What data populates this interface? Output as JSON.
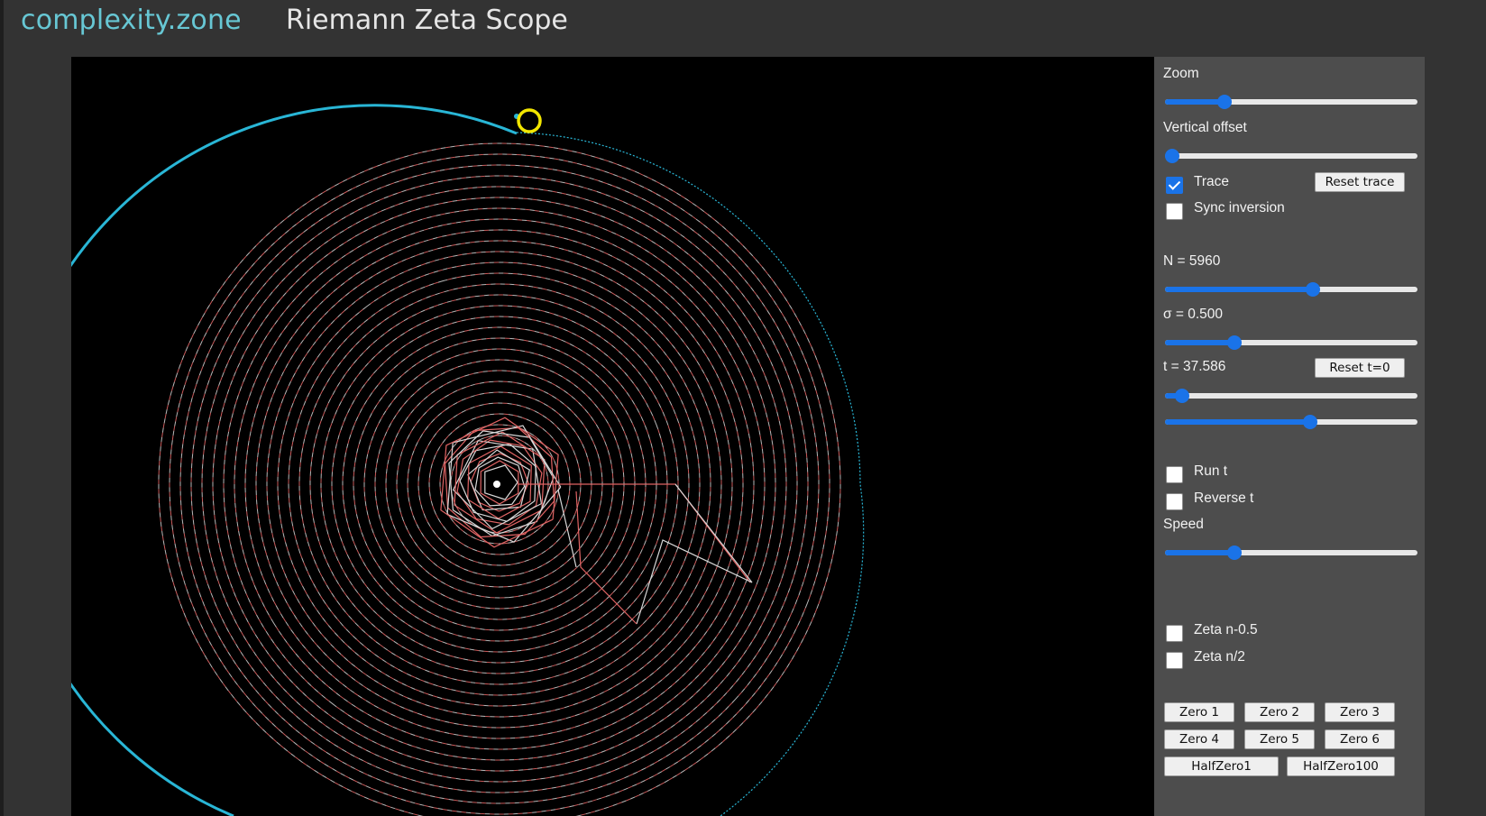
{
  "header": {
    "brand": "complexity.zone",
    "title": "Riemann Zeta Scope"
  },
  "controls": {
    "zoom": {
      "label": "Zoom",
      "value_fraction": 0.22
    },
    "vertical_offset": {
      "label": "Vertical offset",
      "value_fraction": 0.0
    },
    "trace": {
      "label": "Trace",
      "checked": true
    },
    "reset_trace": "Reset trace",
    "sync_inversion": {
      "label": "Sync inversion",
      "checked": false
    },
    "n": {
      "label": "N = 5960",
      "value_fraction": 0.59
    },
    "sigma": {
      "label": "σ = 0.500",
      "value_fraction": 0.26
    },
    "t": {
      "label": "t = 37.586",
      "value_fraction": 0.04
    },
    "reset_t": "Reset t=0",
    "t_fine": {
      "value_fraction": 0.58
    },
    "run_t": {
      "label": "Run t",
      "checked": false
    },
    "reverse_t": {
      "label": "Reverse t",
      "checked": false
    },
    "speed": {
      "label": "Speed",
      "value_fraction": 0.26
    },
    "zeta_n_minus_half": {
      "label": "Zeta n-0.5",
      "checked": false
    },
    "zeta_n_half": {
      "label": "Zeta n/2",
      "checked": false
    },
    "zero_buttons": [
      "Zero 1",
      "Zero 2",
      "Zero 3",
      "Zero 4",
      "Zero 5",
      "Zero 6"
    ],
    "half_zero_buttons": [
      "HalfZero1",
      "HalfZero100"
    ]
  },
  "colors": {
    "brand": "#67c7d4",
    "trace": "#29b6d6",
    "marker": "#f2e600",
    "red_segments": "#e06464",
    "white_segments": "#d8d8d8",
    "accent": "#1a73e8"
  }
}
